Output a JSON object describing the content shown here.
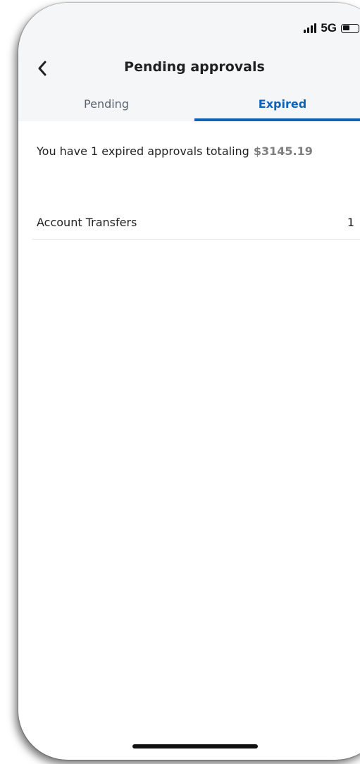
{
  "status_bar": {
    "network": "5G",
    "signal_icon": "signal-bars-icon",
    "battery_icon": "battery-icon"
  },
  "header": {
    "title": "Pending approvals",
    "back_icon": "chevron-left-icon"
  },
  "tabs": [
    {
      "label": "Pending",
      "active": false
    },
    {
      "label": "Expired",
      "active": true
    }
  ],
  "summary": {
    "text": "You have 1 expired approvals totaling",
    "amount": "$3145.19"
  },
  "list": [
    {
      "label": "Account Transfers",
      "count": "1",
      "icon": "chevron-right-icon"
    }
  ],
  "colors": {
    "accent": "#0d63b8",
    "header_bg": "#f4f6f8",
    "muted_text": "#5a6470",
    "amount_text": "#7f7f7f"
  }
}
